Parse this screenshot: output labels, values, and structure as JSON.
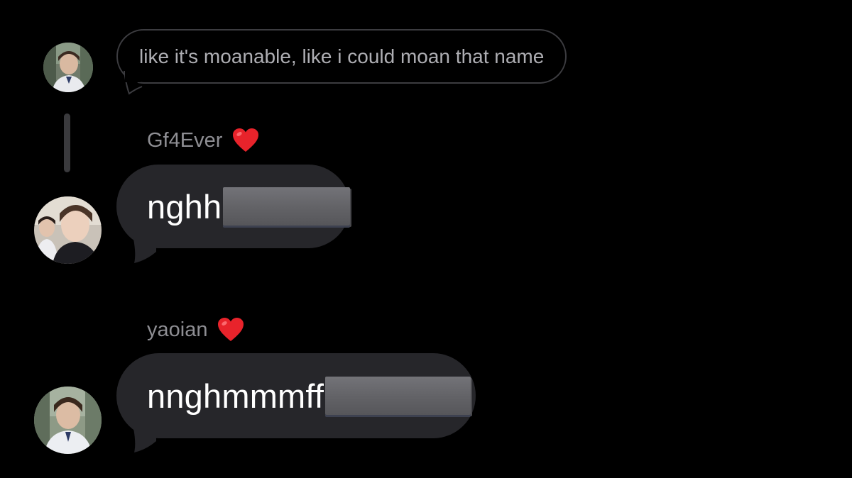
{
  "colors": {
    "background": "#000000",
    "bubble": "#26262a",
    "reply_border": "#3c3c40",
    "sender_text": "#8e8e93",
    "heart": "#e8232b"
  },
  "reply": {
    "text": "like it's moanable, like i could moan that name"
  },
  "messages": [
    {
      "sender": "Gf4Ever",
      "reaction_icon": "red-heart-icon",
      "text": "nghh",
      "redacted": true
    },
    {
      "sender": "yaoian",
      "reaction_icon": "red-heart-icon",
      "text": "nnghmmmff",
      "redacted": true
    }
  ]
}
